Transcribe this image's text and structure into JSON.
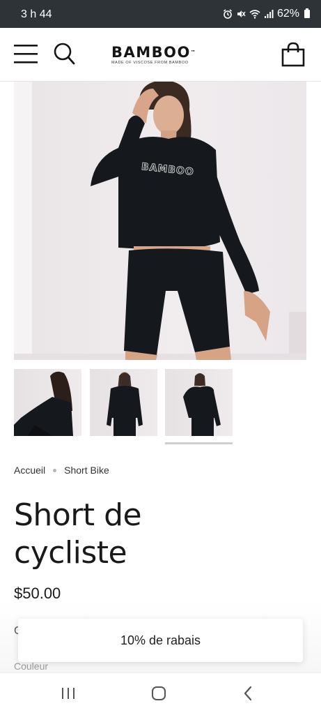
{
  "status_bar": {
    "time": "3 h 44",
    "battery": "62%"
  },
  "header": {
    "logo_text": "BAMBOO",
    "logo_tm": "™",
    "logo_tagline": "MADE OF VISCOSE FROM BAMBOO",
    "icons": [
      "menu-icon",
      "search-icon",
      "shopping-bag-icon"
    ]
  },
  "gallery": {
    "hero_print_text": "BAMBOO",
    "thumbnail_count": 3,
    "selected_thumbnail": 3
  },
  "breadcrumb": {
    "items": [
      "Accueil",
      "Short Bike"
    ]
  },
  "product": {
    "title_line1": "Short de",
    "title_line2": "cycliste",
    "price": "$50.00",
    "partial_label": "C",
    "color_label": "Couleur"
  },
  "discount_banner": {
    "text": "10% de rabais"
  },
  "colors": {
    "status_bar_bg": "#2e3338",
    "garment": "#15181c",
    "background_wall": "#ece7ea"
  }
}
